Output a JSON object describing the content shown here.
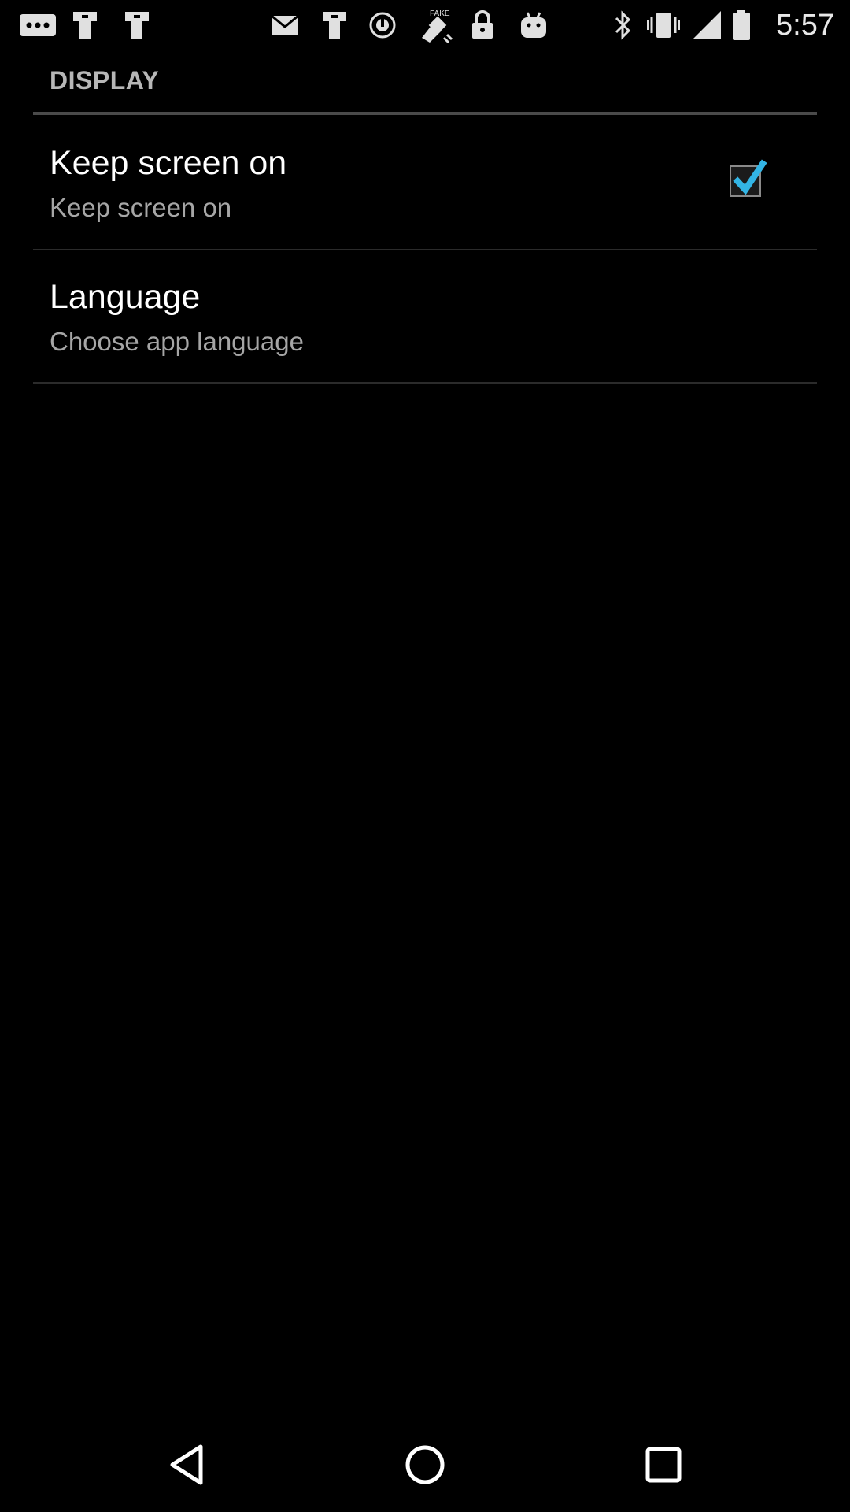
{
  "status_bar": {
    "time": "5:57",
    "left_icons": [
      "more-icon",
      "mount-icon",
      "mount-icon",
      "email-icon",
      "mount-icon",
      "sync-icon",
      "fake-gps-icon",
      "lock-icon",
      "android-icon"
    ],
    "right_icons": [
      "bluetooth-icon",
      "vibrate-icon",
      "signal-icon",
      "battery-icon"
    ]
  },
  "settings": {
    "section_title": "DISPLAY",
    "items": [
      {
        "title": "Keep screen on",
        "summary": "Keep screen on",
        "checked": true
      },
      {
        "title": "Language",
        "summary": "Choose app language"
      }
    ]
  },
  "colors": {
    "background": "#000000",
    "accent": "#33b5e5",
    "title_text": "#ffffff",
    "summary_text": "#a6a6a6",
    "section_text": "#b7b7b7"
  },
  "nav_bar": {
    "buttons": [
      "back-icon",
      "home-icon",
      "recents-icon"
    ]
  }
}
